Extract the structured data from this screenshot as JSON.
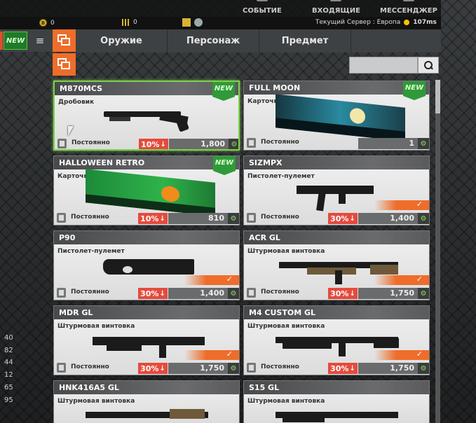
{
  "topbar": {
    "menu": [
      {
        "label": "СОБЫТИЕ",
        "icon": "event-icon"
      },
      {
        "label": "ВХОДЯЩИЕ",
        "icon": "inbox-icon"
      },
      {
        "label": "МЕССЕНДЖЕР",
        "icon": "messenger-icon"
      }
    ]
  },
  "status": {
    "coins": "0",
    "bars": "0",
    "server": "Текущий Сервер : Европа",
    "ping": "107ms"
  },
  "left": {
    "new_label": "NEW",
    "numbers": [
      "40",
      "82",
      "44",
      "12",
      "65",
      "95"
    ]
  },
  "tabs": [
    {
      "label": "Оружие"
    },
    {
      "label": "Персонаж"
    },
    {
      "label": "Предмет"
    }
  ],
  "search": {
    "value": ""
  },
  "items": [
    {
      "name": "M870MCS",
      "type": "Дробовик",
      "new": "NEW",
      "duration": "Постоянно",
      "discount": "10%",
      "price": "1,800"
    },
    {
      "name": "FULL MOON",
      "type": "Карточка",
      "new": "NEW",
      "duration": "Постоянно",
      "discount": "",
      "price": "1"
    },
    {
      "name": "HALLOWEEN RETRO",
      "type": "Карточка",
      "new": "NEW",
      "duration": "Постоянно",
      "discount": "10%",
      "price": "810"
    },
    {
      "name": "SIZMPX",
      "type": "Пистолет-пулемет",
      "new": "",
      "duration": "Постоянно",
      "discount": "30%",
      "price": "1,400"
    },
    {
      "name": "P90",
      "type": "Пистолет-пулемет",
      "new": "",
      "duration": "Постоянно",
      "discount": "30%",
      "price": "1,400"
    },
    {
      "name": "ACR GL",
      "type": "Штурмовая винтовка",
      "new": "",
      "duration": "Постоянно",
      "discount": "30%",
      "price": "1,750"
    },
    {
      "name": "MDR GL",
      "type": "Штурмовая винтовка",
      "new": "",
      "duration": "Постоянно",
      "discount": "30%",
      "price": "1,750"
    },
    {
      "name": "M4 CUSTOM GL",
      "type": "Штурмовая винтовка",
      "new": "",
      "duration": "Постоянно",
      "discount": "30%",
      "price": "1,750"
    },
    {
      "name": "HNK416A5 GL",
      "type": "Штурмовая винтовка",
      "new": "",
      "duration": "",
      "discount": "",
      "price": ""
    },
    {
      "name": "S15 GL",
      "type": "Штурмовая винтовка",
      "new": "",
      "duration": "",
      "discount": "",
      "price": ""
    }
  ]
}
